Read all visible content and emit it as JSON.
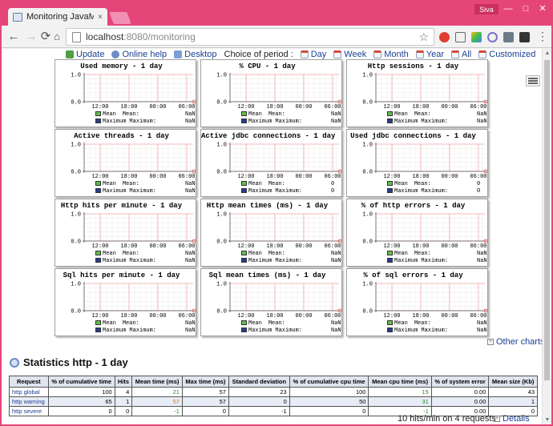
{
  "browser": {
    "tab_title": "Monitoring JavaMelody",
    "tab_close": "×",
    "user": "Siva",
    "minimize": "—",
    "maximize": "□",
    "close": "✕",
    "url_host": "localhost",
    "url_rest": ":8080/monitoring"
  },
  "colors": {
    "window_frame": "#e6457a",
    "link": "#1b3f94",
    "mean_green": "#5fbf49",
    "max_blue": "#2a3c8e",
    "chart_red": "#e05050",
    "header_bg": "#dfe4ee"
  },
  "toolbar_links": [
    {
      "label": "Update",
      "icon": "refresh-icon"
    },
    {
      "label": "Online help",
      "icon": "help-icon"
    },
    {
      "label": "Desktop",
      "icon": "desktop-icon"
    }
  ],
  "period": {
    "label": "Choice of period :",
    "options": [
      "Day",
      "Week",
      "Month",
      "Year",
      "All",
      "Customized"
    ]
  },
  "chart_data": [
    {
      "type": "line",
      "title": "Used memory - 1 day",
      "ylim": [
        0.0,
        1.0
      ],
      "x": [
        "12:00",
        "18:00",
        "00:00",
        "06:00"
      ],
      "yticks": [
        "1.0",
        "0.0"
      ],
      "series": [
        {
          "name": "Mean",
          "mean": "NaN",
          "maximum": "NaN"
        },
        {
          "name": "Maximum"
        }
      ]
    },
    {
      "type": "line",
      "title": "% CPU - 1 day",
      "ylim": [
        0.0,
        1.0
      ],
      "x": [
        "12:00",
        "18:00",
        "00:00",
        "06:00"
      ],
      "yticks": [
        "1.0",
        "0.0"
      ],
      "series": [
        {
          "name": "Mean",
          "mean": "NaN",
          "maximum": "NaN"
        },
        {
          "name": "Maximum"
        }
      ]
    },
    {
      "type": "line",
      "title": "Http sessions - 1 day",
      "ylim": [
        0.0,
        1.0
      ],
      "x": [
        "12:00",
        "18:00",
        "00:00",
        "06:00"
      ],
      "yticks": [
        "1.0",
        "0.0"
      ],
      "series": [
        {
          "name": "Mean",
          "mean": "NaN",
          "maximum": "NaN"
        },
        {
          "name": "Maximum"
        }
      ]
    },
    {
      "type": "line",
      "title": "Active threads - 1 day",
      "ylim": [
        0.0,
        1.0
      ],
      "x": [
        "12:00",
        "18:00",
        "00:00",
        "06:00"
      ],
      "yticks": [
        "1.0",
        "0.0"
      ],
      "series": [
        {
          "name": "Mean",
          "mean": "NaN",
          "maximum": "NaN"
        },
        {
          "name": "Maximum"
        }
      ]
    },
    {
      "type": "line",
      "title": "Active jdbc connections - 1 day",
      "ylim": [
        0.0,
        1.0
      ],
      "x": [
        "12:00",
        "18:00",
        "00:00",
        "06:00"
      ],
      "yticks": [
        "1.0",
        "0.0"
      ],
      "series": [
        {
          "name": "Mean",
          "mean": "0",
          "maximum": "0"
        },
        {
          "name": "Maximum"
        }
      ]
    },
    {
      "type": "line",
      "title": "Used jdbc connections - 1 day",
      "ylim": [
        0.0,
        1.0
      ],
      "x": [
        "12:00",
        "18:00",
        "00:00",
        "06:00"
      ],
      "yticks": [
        "1.0",
        "0.0"
      ],
      "series": [
        {
          "name": "Mean",
          "mean": "0",
          "maximum": "0"
        },
        {
          "name": "Maximum"
        }
      ]
    },
    {
      "type": "line",
      "title": "Http hits per minute - 1 day",
      "ylim": [
        0.0,
        1.0
      ],
      "x": [
        "12:00",
        "18:00",
        "00:00",
        "06:00"
      ],
      "yticks": [
        "1.0",
        "0.0"
      ],
      "series": [
        {
          "name": "Mean",
          "mean": "NaN",
          "maximum": "NaN"
        },
        {
          "name": "Maximum"
        }
      ]
    },
    {
      "type": "line",
      "title": "Http mean times (ms) - 1 day",
      "ylim": [
        0.0,
        1.0
      ],
      "x": [
        "12:00",
        "18:00",
        "00:00",
        "06:00"
      ],
      "yticks": [
        "1.0",
        "0.0"
      ],
      "series": [
        {
          "name": "Mean",
          "mean": "NaN",
          "maximum": "NaN"
        },
        {
          "name": "Maximum"
        }
      ]
    },
    {
      "type": "line",
      "title": "% of http errors - 1 day",
      "ylim": [
        0.0,
        1.0
      ],
      "x": [
        "12:00",
        "18:00",
        "00:00",
        "06:00"
      ],
      "yticks": [
        "1.0",
        "0.0"
      ],
      "series": [
        {
          "name": "Mean",
          "mean": "NaN",
          "maximum": "NaN"
        },
        {
          "name": "Maximum"
        }
      ]
    },
    {
      "type": "line",
      "title": "Sql hits per minute - 1 day",
      "ylim": [
        0.0,
        1.0
      ],
      "x": [
        "12:00",
        "18:00",
        "00:00",
        "06:00"
      ],
      "yticks": [
        "1.0",
        "0.0"
      ],
      "series": [
        {
          "name": "Mean",
          "mean": "NaN",
          "maximum": "NaN"
        },
        {
          "name": "Maximum"
        }
      ]
    },
    {
      "type": "line",
      "title": "Sql mean times (ms) - 1 day",
      "ylim": [
        0.0,
        1.0
      ],
      "x": [
        "12:00",
        "18:00",
        "00:00",
        "06:00"
      ],
      "yticks": [
        "1.0",
        "0.0"
      ],
      "series": [
        {
          "name": "Mean",
          "mean": "NaN",
          "maximum": "NaN"
        },
        {
          "name": "Maximum"
        }
      ]
    },
    {
      "type": "line",
      "title": "% of sql errors - 1 day",
      "ylim": [
        0.0,
        1.0
      ],
      "x": [
        "12:00",
        "18:00",
        "00:00",
        "06:00"
      ],
      "yticks": [
        "1.0",
        "0.0"
      ],
      "series": [
        {
          "name": "Mean",
          "mean": "NaN",
          "maximum": "NaN"
        },
        {
          "name": "Maximum"
        }
      ]
    }
  ],
  "legend": {
    "mean_label": "Mean",
    "mean_value_label": "Mean:",
    "maximum_label": "Maximum",
    "maximum_value_label": "Maximum:"
  },
  "other_charts": "Other charts",
  "stats": {
    "title": "Statistics http - 1 day",
    "columns": [
      "Request",
      "% of cumulative time",
      "Hits",
      "Mean time (ms)",
      "Max time (ms)",
      "Standard deviation",
      "% of cumulative cpu time",
      "Mean cpu time (ms)",
      "% of system error",
      "Mean size (Kb)"
    ],
    "rows": [
      [
        "http global",
        "100",
        "4",
        "21",
        "57",
        "23",
        "100",
        "15",
        "0.00",
        "43"
      ],
      [
        "http warning",
        "65",
        "1",
        "57",
        "57",
        "0",
        "50",
        "31",
        "0.00",
        "1"
      ],
      [
        "http severe",
        "0",
        "0",
        "-1",
        "0",
        "-1",
        "0",
        "-1",
        "0.00",
        "0"
      ]
    ],
    "summary": "10 hits/min on 4 requests",
    "details": "Details"
  }
}
